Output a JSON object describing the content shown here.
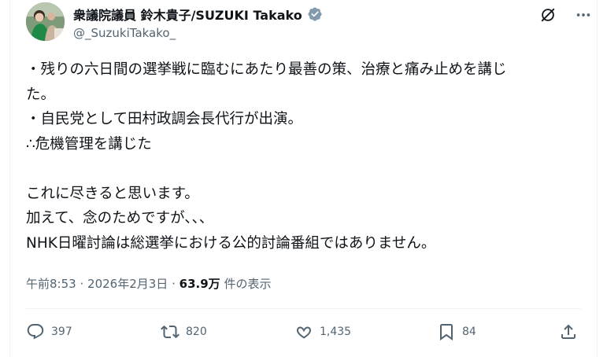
{
  "author": {
    "display_name": "衆議院議員 鈴木貴子/SUZUKI Takako",
    "handle": "@_SuzukiTakako_"
  },
  "post": {
    "lines": [
      "・残りの六日間の選挙戦に臨むにあたり最善の策、治療と痛み止めを講じ",
      "た。",
      "・自民党として田村政調会長代行が出演。",
      "∴危機管理を講じた",
      "",
      "これに尽きると思います。",
      "加えて、念のためですが、、、",
      "NHK日曜討論は総選挙における公的討論番組ではありません。"
    ]
  },
  "meta": {
    "time": "午前8:53",
    "date": "2026年2月3日",
    "separator": "·",
    "views_count": "63.9万",
    "views_label": "件の表示"
  },
  "actions": {
    "replies": "397",
    "reposts": "820",
    "likes": "1,435",
    "bookmarks": "84"
  },
  "icons": {
    "verified": "verified-badge-icon",
    "grok": "grok-icon",
    "more": "more-icon",
    "reply": "reply-icon",
    "repost": "repost-icon",
    "like": "heart-icon",
    "bookmark": "bookmark-icon",
    "share": "share-icon"
  },
  "colors": {
    "text": "#0f1419",
    "secondary": "#536471",
    "verified_badge": "#829aab",
    "divider": "#eff3f4"
  }
}
